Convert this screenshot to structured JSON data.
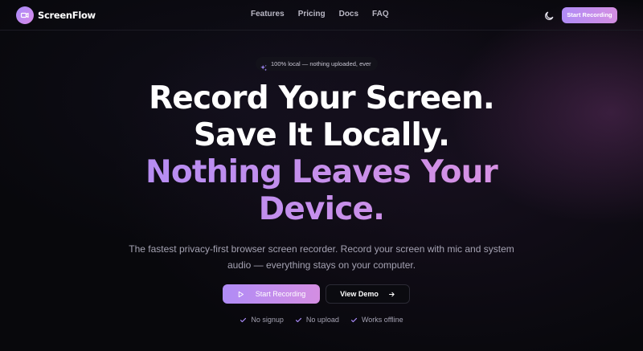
{
  "brand": {
    "name": "ScreenFlow",
    "logo_icon": "video-camera-icon"
  },
  "nav": {
    "links": [
      "Features",
      "Pricing",
      "Docs",
      "FAQ"
    ],
    "theme_toggle_icon": "moon-icon",
    "cta_label": "Start Recording"
  },
  "badge": {
    "icon": "sparkles-icon",
    "text": "100% local — nothing uploaded, ever"
  },
  "hero": {
    "headline_lines": [
      "Record Your Screen.",
      "Save It Locally."
    ],
    "headline_highlight_lines": [
      "Nothing Leaves Your",
      "Device."
    ],
    "subtext": "The fastest privacy-first browser screen recorder. Record your screen with mic and system audio — everything stays on your computer."
  },
  "cta": {
    "primary_label": "Start Recording",
    "primary_icon": "play-icon",
    "secondary_label": "View Demo",
    "secondary_icon": "arrow-right-icon"
  },
  "features": [
    "No signup",
    "No upload",
    "Works offline"
  ],
  "colors": {
    "background": "#08080c",
    "accent_start": "#a98af8",
    "accent_end": "#e392dc",
    "text_muted": "#a4a2b2",
    "check": "#a98af8"
  }
}
